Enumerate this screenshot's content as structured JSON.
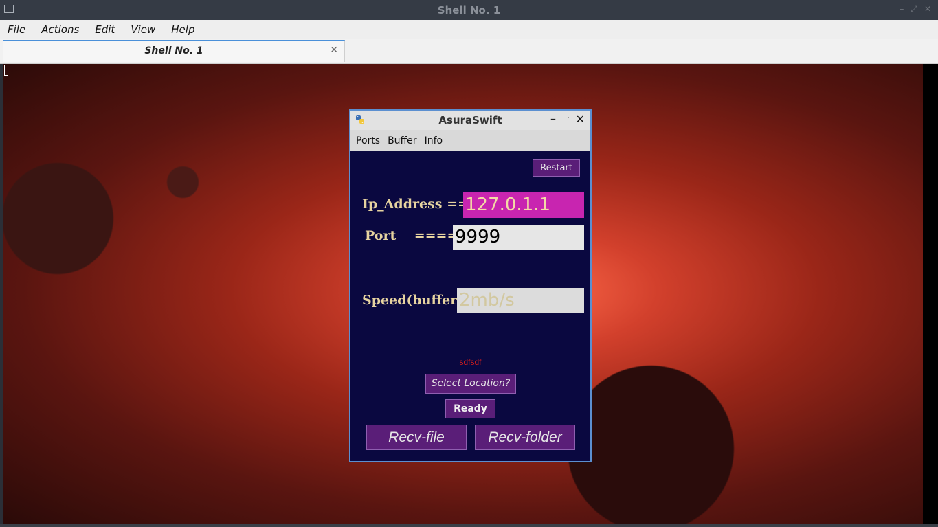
{
  "window": {
    "title": "Shell No. 1",
    "icon": "terminal-icon"
  },
  "menubar": {
    "items": [
      "File",
      "Actions",
      "Edit",
      "View",
      "Help"
    ]
  },
  "tabs": [
    {
      "label": "Shell No. 1",
      "close": "✕"
    }
  ],
  "dialog": {
    "title": "AsuraSwift",
    "icon": "python-icon",
    "controls": {
      "minimize": "–",
      "maximize": "·",
      "close": "✕"
    },
    "menu": [
      "Ports",
      "Buffer",
      "Info"
    ],
    "restart_label": "Restart",
    "ip_label": "Ip_Address ==>",
    "ip_value": "127.0.1.1",
    "port_label": "Port    ====>",
    "port_value": "9999",
    "speed_label": "Speed(buffer):",
    "speed_placeholder": "2mb/s",
    "status_text": "sdfsdf",
    "select_location_label": "Select Location?",
    "ready_label": "Ready",
    "recv_file_label": "Recv-file",
    "recv_folder_label": "Recv-folder",
    "colors": {
      "background": "#0a0840",
      "button": "#5a1e78",
      "ip_field": "#c825b0",
      "label_text": "#e6d3a0",
      "status_text": "#d11d1d"
    }
  }
}
